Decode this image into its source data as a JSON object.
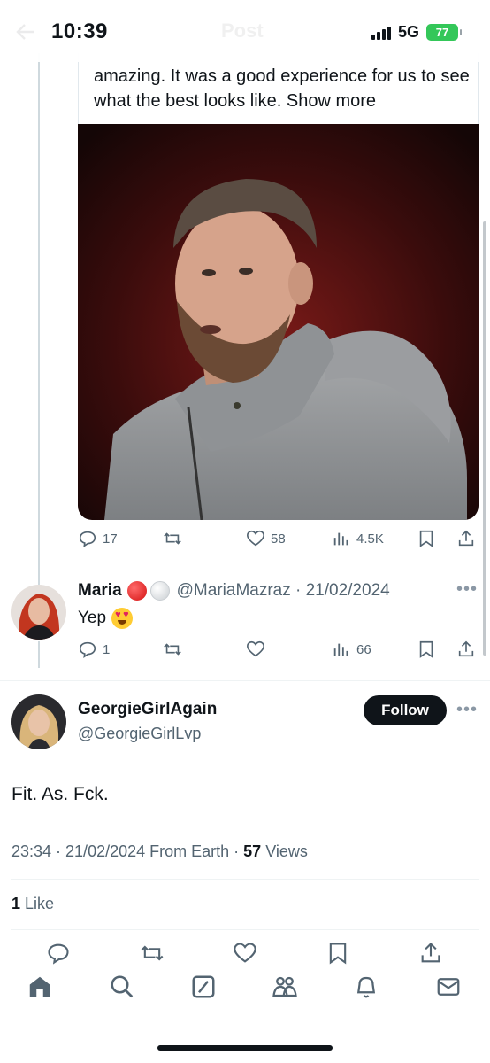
{
  "status_bar": {
    "time": "10:39",
    "network": "5G",
    "battery": "77"
  },
  "header": {
    "title": "Post"
  },
  "quoted_tweet": {
    "text_line1": "amazing. It was a good experience for us to",
    "text_line2": "see what the best looks like.",
    "show_more": "Show more",
    "actions": {
      "replies": "17",
      "likes": "58",
      "views": "4.5K"
    }
  },
  "reply": {
    "name": "Maria",
    "handle_date": "@MariaMazraz · 21/02/2024",
    "text": "Yep",
    "actions": {
      "replies": "1",
      "views": "66"
    }
  },
  "main_tweet": {
    "name": "GeorgieGirlAgain",
    "handle": "@GeorgieGirlLvp",
    "follow_label": "Follow",
    "text": "Fit. As. Fck.",
    "meta_time": "23:34 · 21/02/2024 From Earth · ",
    "views_count": "57",
    "views_label": " Views",
    "likes_count": "1",
    "likes_label": " Like"
  },
  "icons": {
    "reply": "reply-icon",
    "retweet": "retweet-icon",
    "like": "heart-icon",
    "views": "views-icon",
    "bookmark": "bookmark-icon",
    "share": "share-icon",
    "tabs": [
      "home-icon",
      "search-icon",
      "grok-icon",
      "communities-icon",
      "notifications-icon",
      "messages-icon"
    ]
  },
  "colors": {
    "text": "#0f1419",
    "secondary": "#536471",
    "battery": "#34c759",
    "follow_bg": "#0f1419"
  }
}
